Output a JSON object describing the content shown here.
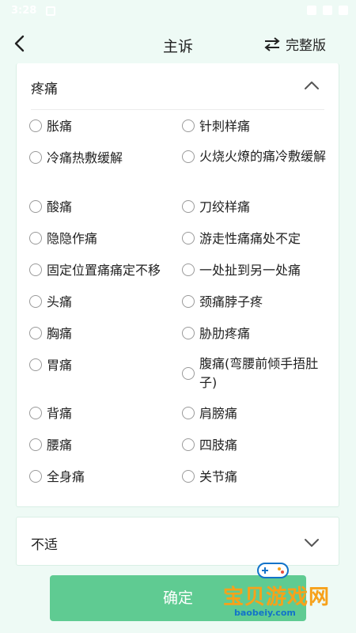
{
  "status_bar": {
    "time": "3:28"
  },
  "header": {
    "title": "主诉",
    "full_version_label": "完整版"
  },
  "sections": [
    {
      "title": "疼痛",
      "expanded": true,
      "options": [
        "胀痛",
        "针刺样痛",
        "冷痛热敷缓解",
        "火烧火燎的痛冷敷缓解",
        "酸痛",
        "刀绞样痛",
        "隐隐作痛",
        "游走性痛痛处不定",
        "固定位置痛痛定不移",
        "一处扯到另一处痛",
        "头痛",
        "颈痛脖子疼",
        "胸痛",
        "胁肋疼痛",
        "胃痛",
        "腹痛(弯腰前倾手捂肚子)",
        "背痛",
        "肩膀痛",
        "腰痛",
        "四肢痛",
        "全身痛",
        "关节痛"
      ]
    },
    {
      "title": "不适",
      "expanded": false
    }
  ],
  "confirm_label": "确定",
  "watermark": {
    "text": "宝贝游戏网",
    "url": "baobeiy.com"
  },
  "colors": {
    "accent": "#5fcb92",
    "background": "#eefaf5",
    "watermark_orange": "#f7a11a",
    "watermark_blue": "#1273c9"
  }
}
